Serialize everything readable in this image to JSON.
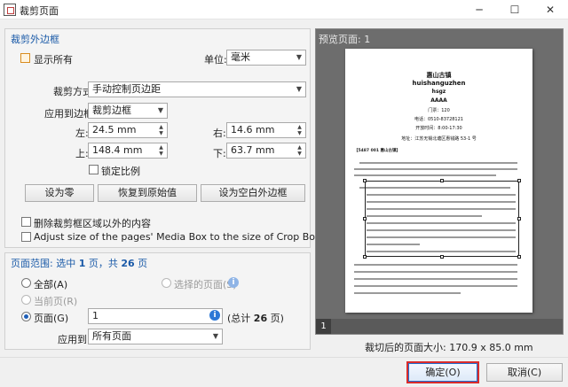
{
  "window": {
    "title": "裁剪页面",
    "minimize": "─",
    "maximize": "☐",
    "close": "✕"
  },
  "crop_margins": {
    "group_title": "裁剪外边框",
    "show_all_label": "显示所有",
    "unit_label": "单位:",
    "unit_value": "毫米",
    "crop_mode_label": "裁剪方式",
    "crop_mode_value": "手动控制页边距",
    "apply_to_label": "应用到边框",
    "apply_to_value": "裁剪边框",
    "left_label": "左:",
    "left_value": "24.5 mm",
    "right_label": "右:",
    "right_value": "14.6 mm",
    "top_label": "上:",
    "top_value": "148.4 mm",
    "bottom_label": "下:",
    "bottom_value": "63.7 mm",
    "lock_ratio_label": "锁定比例",
    "set_zero_button": "设为零",
    "restore_button": "恢复到原始值",
    "set_blank_button": "设为空白外边框",
    "delete_outside_label": "删除裁剪框区域以外的内容",
    "adjust_media_box_label": "Adjust size of the pages' Media Box to the size of Crop Box"
  },
  "page_range": {
    "title_prefix": "页面范围: 选中 ",
    "selected_count": "1",
    "title_middle": " 页，共 ",
    "total_count": "26",
    "title_suffix": " 页",
    "all_label": "全部(A)",
    "selected_pages_label": "选择的页面(S)",
    "current_page_label": "当前页(R)",
    "pages_label": "页面(G)",
    "pages_value": "1",
    "total_prefix": "(总计 ",
    "total_value": "26",
    "total_suffix": " 页)",
    "apply_to_label": "应用到:",
    "apply_to_value": "所有页面"
  },
  "preview": {
    "header": "预览页面: 1",
    "page_number": "1",
    "size_label": "裁切后的页面大小:",
    "size_value": "170.9 x 85.0 mm",
    "page_text": {
      "title_cn": "惠山古镇",
      "title_pinyin": "huishanguzhen",
      "abbr": "hsgz",
      "rating": "AAAA",
      "tickets": "门票：120",
      "phone": "电话：0510-83728121",
      "hours": "开放时间：8:00-17:30",
      "address": "地址：江苏无锡北塘区惠钱路 53-1 号",
      "section": "【5487 001 惠山古镇】"
    }
  },
  "footer": {
    "ok_button": "确定(O)",
    "cancel_button": "取消(C)"
  }
}
